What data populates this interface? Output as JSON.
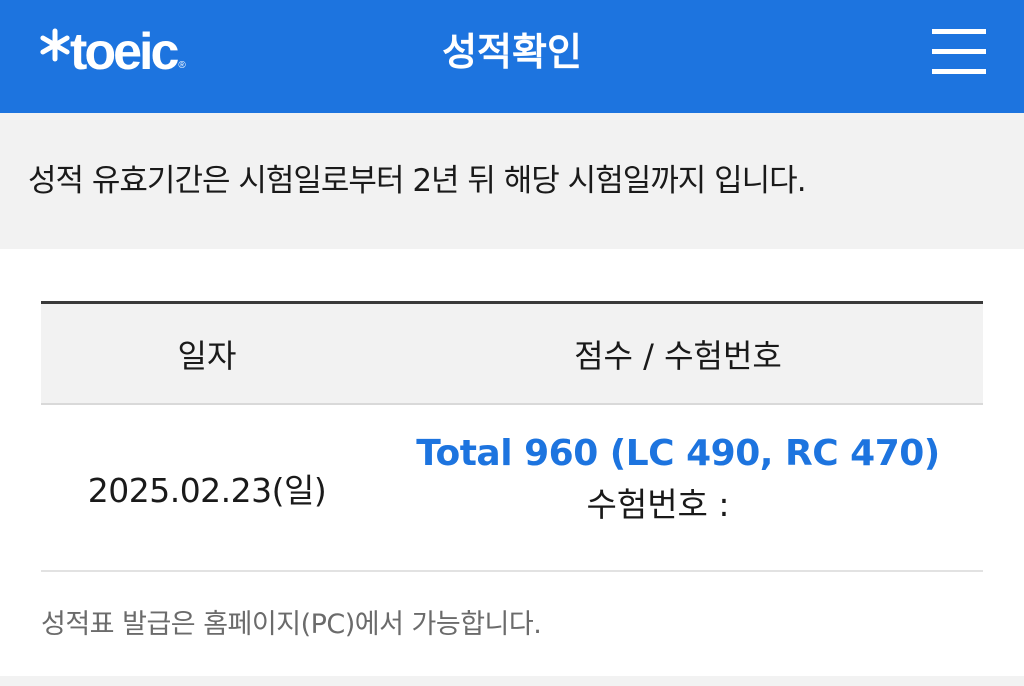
{
  "header": {
    "logo_text": "toeic",
    "logo_registered": "®",
    "title": "성적확인",
    "menu_icon": "hamburger-menu-icon",
    "background_color": "#1d74df"
  },
  "notice": {
    "text": "성적 유효기간은 시험일로부터 2년 뒤 해당 시험일까지 입니다."
  },
  "table": {
    "headers": {
      "date": "일자",
      "score": "점수 / 수험번호"
    },
    "rows": [
      {
        "date": "2025.02.23(일)",
        "score": "Total 960 (LC 490, RC 470)",
        "exam_number_label": "수험번호 :",
        "exam_number": ""
      }
    ],
    "accent_color": "#1d74df"
  },
  "footer": {
    "note": "성적표 발급은 홈페이지(PC)에서 가능합니다."
  }
}
